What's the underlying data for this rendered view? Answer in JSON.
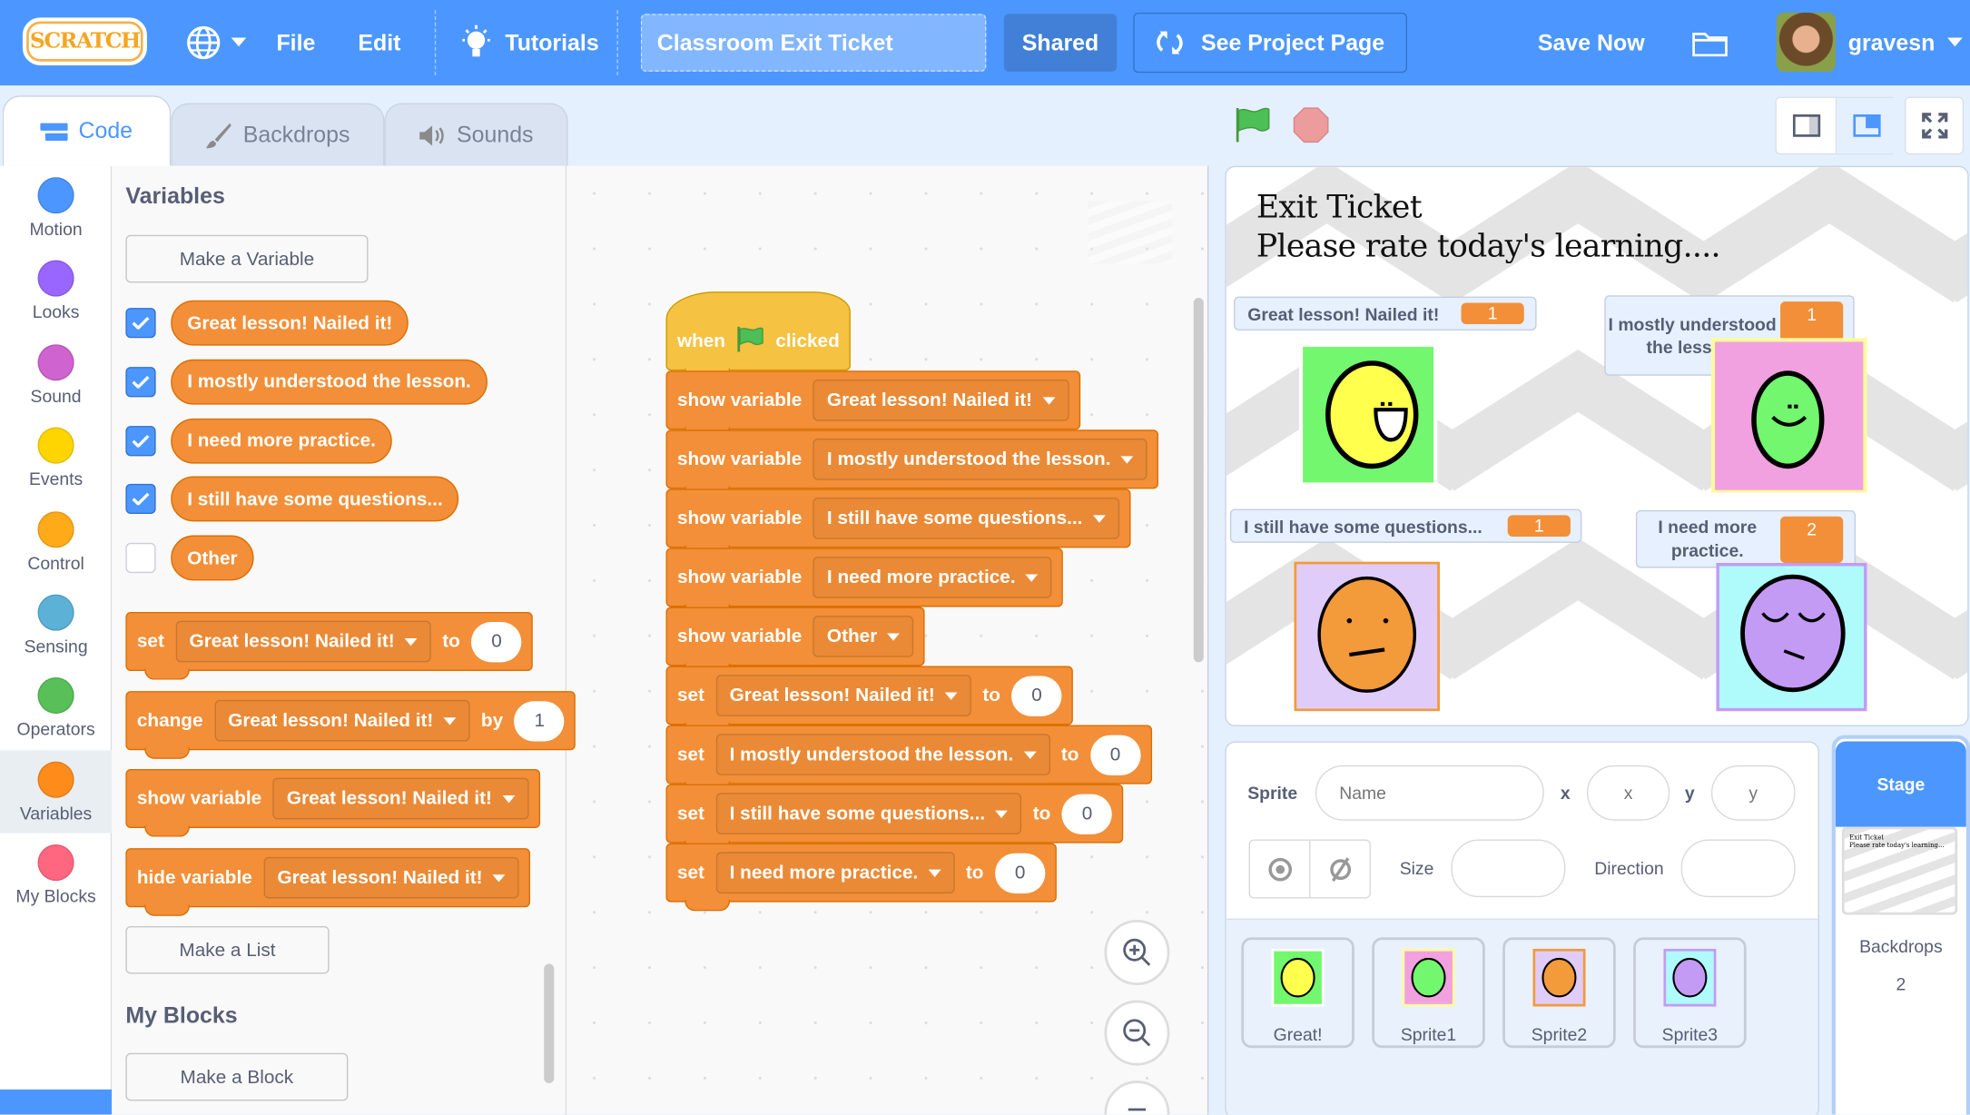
{
  "menubar": {
    "logo": "SCRATCH",
    "file": "File",
    "edit": "Edit",
    "tutorials": "Tutorials",
    "project_title": "Classroom Exit Ticket",
    "shared": "Shared",
    "see_project_page": "See Project Page",
    "save_now": "Save Now",
    "username": "gravesn"
  },
  "tabs": [
    {
      "label": "Code",
      "active": true
    },
    {
      "label": "Backdrops",
      "active": false
    },
    {
      "label": "Sounds",
      "active": false
    }
  ],
  "categories": [
    {
      "label": "Motion",
      "color": "#4c97ff"
    },
    {
      "label": "Looks",
      "color": "#9966ff"
    },
    {
      "label": "Sound",
      "color": "#cf63cf"
    },
    {
      "label": "Events",
      "color": "#ffd500"
    },
    {
      "label": "Control",
      "color": "#ffab19"
    },
    {
      "label": "Sensing",
      "color": "#5cb1d6"
    },
    {
      "label": "Operators",
      "color": "#59c059"
    },
    {
      "label": "Variables",
      "color": "#ff8c1a",
      "selected": true
    },
    {
      "label": "My Blocks",
      "color": "#ff6680"
    }
  ],
  "colors": {
    "variables": "#f28f38",
    "events": "#f5c242",
    "accent": "#4c97ff"
  },
  "palette": {
    "heading": "Variables",
    "make_variable": "Make a Variable",
    "variables": [
      {
        "name": "Great lesson! Nailed it!",
        "checked": true
      },
      {
        "name": "I mostly understood the lesson.",
        "checked": true
      },
      {
        "name": "I need more practice.",
        "checked": true
      },
      {
        "name": "I still have some questions...",
        "checked": true
      },
      {
        "name": "Other",
        "checked": false
      }
    ],
    "blocks": [
      {
        "parts": [
          {
            "t": "text",
            "v": "set"
          },
          {
            "t": "dd",
            "v": "Great lesson! Nailed it!"
          },
          {
            "t": "text",
            "v": "to"
          },
          {
            "t": "num",
            "v": "0"
          }
        ]
      },
      {
        "parts": [
          {
            "t": "text",
            "v": "change"
          },
          {
            "t": "dd",
            "v": "Great lesson! Nailed it!"
          },
          {
            "t": "text",
            "v": "by"
          },
          {
            "t": "num",
            "v": "1"
          }
        ]
      },
      {
        "parts": [
          {
            "t": "text",
            "v": "show variable"
          },
          {
            "t": "dd",
            "v": "Great lesson! Nailed it!"
          }
        ]
      },
      {
        "parts": [
          {
            "t": "text",
            "v": "hide variable"
          },
          {
            "t": "dd",
            "v": "Great lesson! Nailed it!"
          }
        ]
      }
    ],
    "make_list": "Make a List",
    "my_blocks_heading": "My Blocks",
    "make_block": "Make a Block"
  },
  "script": [
    {
      "hat": true,
      "parts": [
        {
          "t": "text",
          "v": "when"
        },
        {
          "t": "flag",
          "v": "green-flag-icon"
        },
        {
          "t": "text",
          "v": "clicked"
        }
      ]
    },
    {
      "parts": [
        {
          "t": "text",
          "v": "show variable"
        },
        {
          "t": "dd",
          "v": "Great lesson! Nailed it!"
        }
      ]
    },
    {
      "parts": [
        {
          "t": "text",
          "v": "show variable"
        },
        {
          "t": "dd",
          "v": "I mostly understood the lesson."
        }
      ]
    },
    {
      "parts": [
        {
          "t": "text",
          "v": "show variable"
        },
        {
          "t": "dd",
          "v": "I still have some questions..."
        }
      ]
    },
    {
      "parts": [
        {
          "t": "text",
          "v": "show variable"
        },
        {
          "t": "dd",
          "v": "I need more practice."
        }
      ]
    },
    {
      "parts": [
        {
          "t": "text",
          "v": "show variable"
        },
        {
          "t": "dd",
          "v": "Other"
        }
      ]
    },
    {
      "parts": [
        {
          "t": "text",
          "v": "set"
        },
        {
          "t": "dd",
          "v": "Great lesson! Nailed it!"
        },
        {
          "t": "text",
          "v": "to"
        },
        {
          "t": "num",
          "v": "0"
        }
      ]
    },
    {
      "parts": [
        {
          "t": "text",
          "v": "set"
        },
        {
          "t": "dd",
          "v": "I mostly understood the lesson."
        },
        {
          "t": "text",
          "v": "to"
        },
        {
          "t": "num",
          "v": "0"
        }
      ]
    },
    {
      "parts": [
        {
          "t": "text",
          "v": "set"
        },
        {
          "t": "dd",
          "v": "I still have some questions..."
        },
        {
          "t": "text",
          "v": "to"
        },
        {
          "t": "num",
          "v": "0"
        }
      ]
    },
    {
      "parts": [
        {
          "t": "text",
          "v": "set"
        },
        {
          "t": "dd",
          "v": "I need more practice."
        },
        {
          "t": "text",
          "v": "to"
        },
        {
          "t": "num",
          "v": "0"
        }
      ]
    }
  ],
  "stage": {
    "title_line1": "Exit Ticket",
    "title_line2": "Please rate today's learning....",
    "monitors": [
      {
        "label": "Great lesson! Nailed it!",
        "value": "1"
      },
      {
        "label": "I mostly understood the lesson.",
        "value": "1"
      },
      {
        "label": "I still have some questions...",
        "value": "1"
      },
      {
        "label": "I need more practice.",
        "value": "2"
      }
    ]
  },
  "sprite_info": {
    "sprite_label": "Sprite",
    "name_placeholder": "Name",
    "x_label": "x",
    "x_placeholder": "x",
    "y_label": "y",
    "y_placeholder": "y",
    "size_label": "Size",
    "direction_label": "Direction"
  },
  "sprites": [
    {
      "name": "Great!"
    },
    {
      "name": "Sprite1"
    },
    {
      "name": "Sprite2"
    },
    {
      "name": "Sprite3"
    }
  ],
  "stage_pane": {
    "title": "Stage",
    "backdrops_label": "Backdrops",
    "backdrops_count": "2",
    "thumb_line1": "Exit Ticket",
    "thumb_line2": "Please rate today's learning..."
  }
}
